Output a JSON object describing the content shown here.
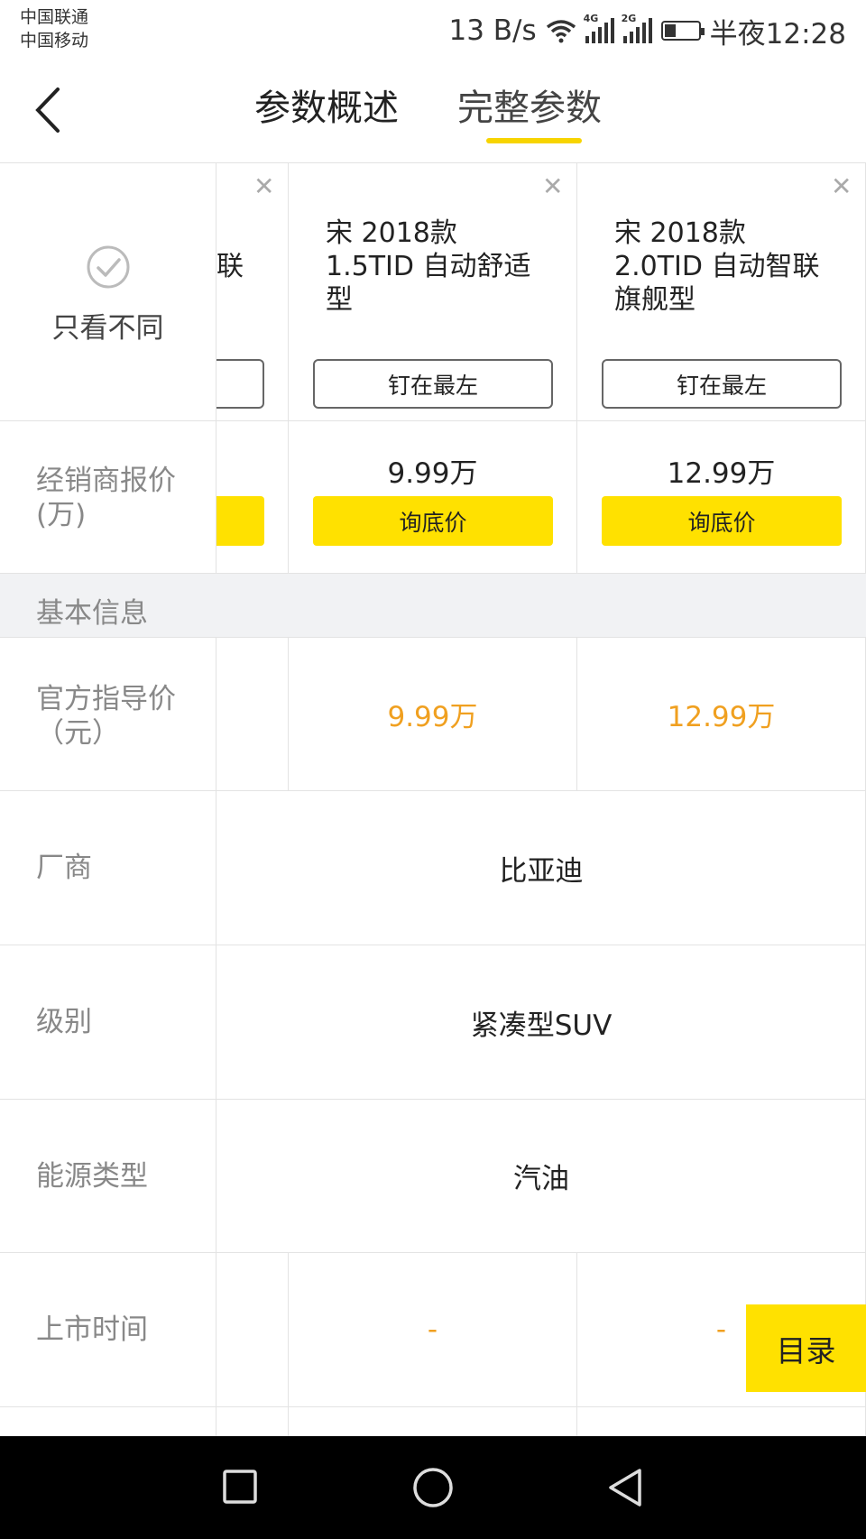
{
  "status_bar": {
    "carrier_1": "中国联通",
    "carrier_2": "中国移动",
    "net_speed": "13 B/s",
    "sig1_tag": "4G",
    "sig2_tag": "2G",
    "time": "半夜12:28"
  },
  "header": {
    "tab_overview": "参数概述",
    "tab_full": "完整参数"
  },
  "only_diff_label": "只看不同",
  "cars": [
    {
      "name_partial": "联",
      "pin": "",
      "dealer_price": "",
      "ask": "",
      "official_price": "",
      "launch": ""
    },
    {
      "name_line1": "宋 2018款",
      "name_line2": "1.5TID 自动舒适",
      "name_line3": "型",
      "pin": "钉在最左",
      "dealer_price": "9.99万",
      "ask": "询底价",
      "official_price": "9.99万",
      "launch": "-"
    },
    {
      "name_line1": "宋 2018款",
      "name_line2": "2.0TID 自动智联",
      "name_line3": "旗舰型",
      "pin": "钉在最左",
      "dealer_price": "12.99万",
      "ask": "询底价",
      "official_price": "12.99万",
      "launch": "-"
    }
  ],
  "rows": {
    "dealer_price_label_1": "经销商报价",
    "dealer_price_label_2": "(万)",
    "section_basic": "基本信息",
    "official_price_label_1": "官方指导价",
    "official_price_label_2": "（元）",
    "maker_label": "厂商",
    "maker_value": "比亚迪",
    "level_label": "级别",
    "level_value": "紧凑型SUV",
    "energy_label": "能源类型",
    "energy_value": "汽油",
    "launch_label": "上市时间"
  },
  "float_button": "目录",
  "colors": {
    "accent": "#ffe100",
    "price": "#f0a020",
    "label": "#888888"
  }
}
